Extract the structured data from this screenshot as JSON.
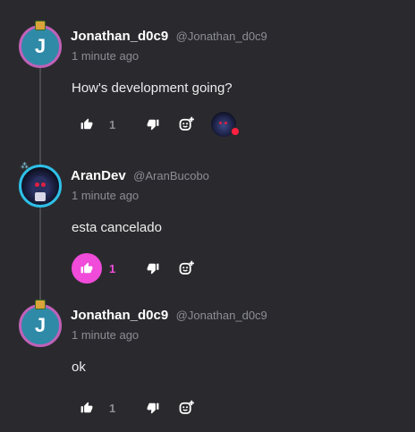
{
  "comments": [
    {
      "avatar_letter": "J",
      "username": "Jonathan_d0c9",
      "handle": "@Jonathan_d0c9",
      "timestamp": "1 minute ago",
      "text": "How's development going?",
      "like_count": "1",
      "liked": false,
      "has_reaction": true
    },
    {
      "avatar_letter": "",
      "username": "AranDev",
      "handle": "@AranBucobo",
      "timestamp": "1 minute ago",
      "text": "esta cancelado",
      "like_count": "1",
      "liked": true,
      "has_reaction": false
    },
    {
      "avatar_letter": "J",
      "username": "Jonathan_d0c9",
      "handle": "@Jonathan_d0c9",
      "timestamp": "1 minute ago",
      "text": "ok",
      "like_count": "1",
      "liked": false,
      "has_reaction": false
    }
  ],
  "icons": {
    "like": "thumbs-up-icon",
    "dislike": "thumbs-down-icon",
    "react": "add-reaction-icon"
  },
  "colors": {
    "background": "#2a2a2e",
    "accent": "#f04bd9",
    "avatar_bg": "#2f8aa8",
    "avatar_ring": "#c061b8",
    "avatar_ring_alt": "#2ec0e8",
    "muted_text": "#8c8c94"
  }
}
